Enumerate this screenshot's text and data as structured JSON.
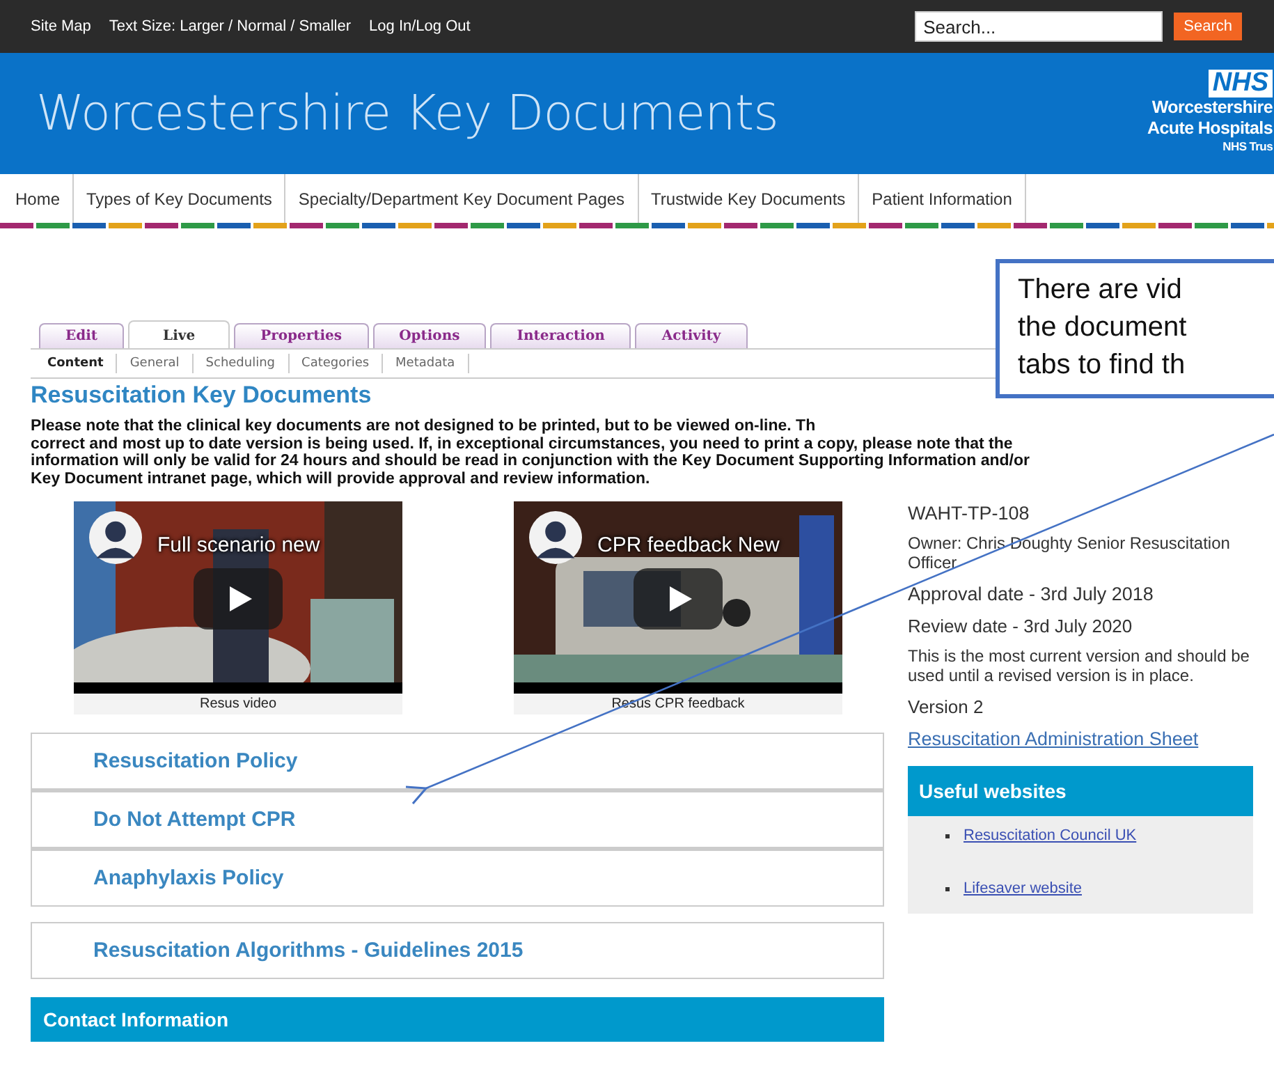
{
  "top_bar": {
    "links": [
      "Site Map",
      "Text Size: Larger / Normal / Smaller",
      "Log In/Log Out"
    ],
    "search": {
      "placeholder": "Search...",
      "button": "Search"
    }
  },
  "banner": {
    "title": "Worcestershire Key Documents",
    "logo": {
      "mark": "NHS",
      "lines": [
        "Worcestershire",
        "Acute Hospitals",
        "NHS Trus"
      ]
    }
  },
  "nav": [
    {
      "label": "Home",
      "selected": false
    },
    {
      "label": "Types of Key Documents",
      "selected": false
    },
    {
      "label": "Specialty/Department Key Document Pages",
      "selected": false
    },
    {
      "label": "Trustwide Key Documents",
      "selected": false
    },
    {
      "label": "Patient Information",
      "selected": false
    }
  ],
  "tabs": [
    {
      "label": "Edit",
      "selected": false
    },
    {
      "label": "Live",
      "selected": true
    },
    {
      "label": "Properties",
      "selected": false
    },
    {
      "label": "Options",
      "selected": false
    },
    {
      "label": "Interaction",
      "selected": false
    },
    {
      "label": "Activity",
      "selected": false
    }
  ],
  "subtabs": [
    {
      "label": "Content",
      "selected": true
    },
    {
      "label": "General",
      "selected": false
    },
    {
      "label": "Scheduling",
      "selected": false
    },
    {
      "label": "Categories",
      "selected": false
    },
    {
      "label": "Metadata",
      "selected": false
    }
  ],
  "heading": "Resuscitation Key Documents",
  "notice_lines": [
    "Please note that the clinical key documents are not designed to be printed, but to be viewed on-line.  Th",
    "correct and most up to date version is being used.  If, in exceptional circumstances, you need to print a copy, please note that the",
    "information will only be valid for 24 hours and should be read in conjunction with the Key Document Supporting Information and/or",
    "Key Document intranet page, which will provide approval and review information."
  ],
  "videos": [
    {
      "title": "Full scenario new",
      "caption": "Resus video"
    },
    {
      "title": "CPR feedback New",
      "caption": "Resus CPR feedback"
    }
  ],
  "accordion": [
    {
      "label": "Resuscitation Policy"
    },
    {
      "label": "Do Not Attempt CPR"
    },
    {
      "label": "Anaphylaxis Policy"
    }
  ],
  "algorithms": "Resuscitation Algorithms - Guidelines 2015",
  "contact": "Contact Information",
  "details": {
    "code": "WAHT-TP-108",
    "owner": "Owner: Chris Doughty Senior Resuscitation Officer",
    "approval": "Approval date - 3rd July 2018",
    "review": "Review date - 3rd July 2020",
    "note": "This is the most current version and should be used until a revised version is in place.",
    "version": "Version 2",
    "link": "Resuscitation Administration Sheet"
  },
  "useful": {
    "title": "Useful websites",
    "links": [
      "Resuscitation Council UK",
      "Lifesaver website"
    ]
  },
  "callout": {
    "lines": [
      "There are vid",
      "the document",
      "tabs to find th"
    ]
  }
}
